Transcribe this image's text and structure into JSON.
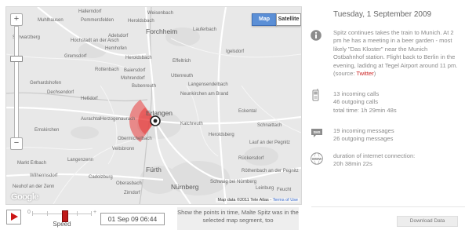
{
  "map": {
    "type_buttons": {
      "map": "Map",
      "satellite": "Satellite"
    },
    "zoom": {
      "plus": "+",
      "minus": "−",
      "level_fraction": 0.72
    },
    "logo": "Google",
    "attribution": {
      "data": "Map data ©2011 Tele Atlas - ",
      "terms": "Terms of Use"
    },
    "places": [
      "Hallerndorf",
      "Weisenbach",
      "Muhlhausen",
      "Pommersfelden",
      "Heroldsbach",
      "Hochstadt an der Aisch",
      "Adelsdorf",
      "Forchheim",
      "Lauferbach",
      "Schwarzberg",
      "Gremsdorf",
      "Hemhofen",
      "Heroldsbach",
      "Effeltrich",
      "Igelsdorf",
      "Rottenbach",
      "Baiersdorf",
      "Mohrendorf",
      "Uttenreuth",
      "Langensendelbach",
      "Dechsendorf",
      "Bubenreuth",
      "Neunkirchen am Brand",
      "Heßdorf",
      "Gerhardshofen",
      "Erlangen",
      "Aurachtal",
      "Herzogenaurach",
      "Emskirchen",
      "Eckental",
      "Kalchreuth",
      "Schnaittach",
      "Heroldsberg",
      "Lauf an der Pegnitz",
      "Obermichelbach",
      "Veitsbronn",
      "Langenzenn",
      "Markt Erlbach",
      "Fürth",
      "Wilhermsdorf",
      "Cadolzburg",
      "Rückersdorf",
      "Neuhof an der Zenn",
      "Röthenbach an der Pegnitz",
      "Schwaig bei Nürnberg",
      "Nürnberg",
      "Oberasbach",
      "Zirndorf",
      "Leinburg",
      "Feucht"
    ]
  },
  "playback": {
    "speed_label": "Speed",
    "speed_min": "0",
    "speed_max": "+",
    "speed_fraction": 0.55,
    "date": "01 Sep 09 06:44",
    "hint": "Show the points in time, Malte Spitz was in the selected map segment, too"
  },
  "panel": {
    "date_heading": "Tuesday, 1 September 2009",
    "description": "Spitz continues takes the train to Munich. At 2 pm he has a meeting in a beer garden - most likely \"Das Kloster\" near the Munich Ostbahnhof station. Flight back to Berlin in the evening, ladidng at Tegel Airport around 11 pm. (source: ",
    "source_link": "Twitter",
    "description_end": ")",
    "calls": {
      "incoming": "13 incoming calls",
      "outgoing": "46 outgoing calls",
      "total": "total time: 1h 29min 48s"
    },
    "messages": {
      "incoming": "19 incoming messages",
      "outgoing": "26 outgoing messages"
    },
    "internet": {
      "label": "duration of internet connection:",
      "duration": "20h 38min 22s"
    },
    "download": "Download Data",
    "icons": {
      "info": "info-icon",
      "phone": "phone-icon",
      "sms": "sms-icon",
      "www": "www-icon",
      "sms_badge": "SMS",
      "www_badge": "WWW"
    },
    "colors": {
      "accent": "#cc2222",
      "map_button": "#5b8fd6",
      "location_marker": "#e83a3a"
    }
  }
}
